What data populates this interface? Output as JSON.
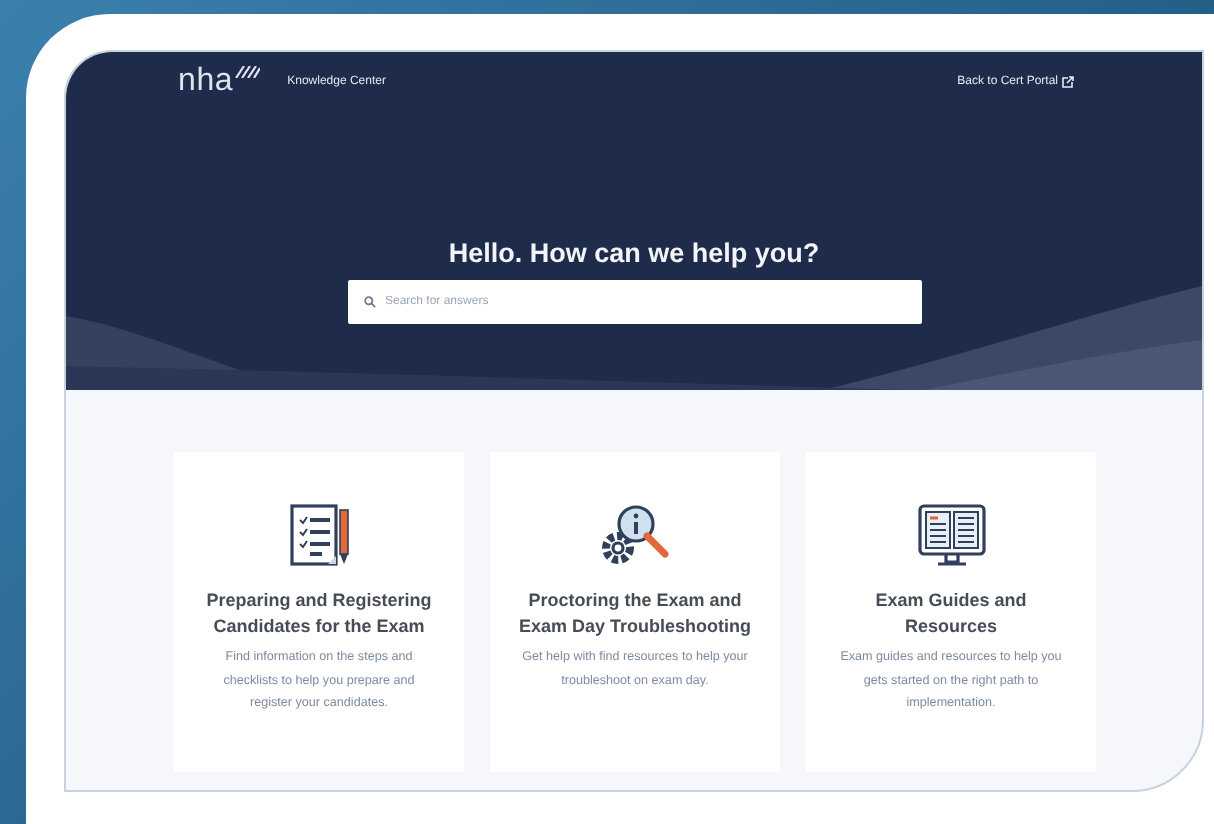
{
  "header": {
    "logo": "nha",
    "nav_link": "Knowledge Center",
    "back_link": "Back to Cert Portal"
  },
  "hero": {
    "title": "Hello. How can we help you?",
    "search": {
      "placeholder": "Search for answers"
    }
  },
  "cards": [
    {
      "kind": "checklist",
      "title": "Preparing and Registering Candidates for the Exam",
      "description": "Find information on the steps and checklists to help you prepare and register your candidates."
    },
    {
      "kind": "troubleshoot",
      "title": "Proctoring the Exam and Exam Day Troubleshooting",
      "description": "Get help with find resources to help your troubleshoot on exam day."
    },
    {
      "kind": "guide",
      "title": "Exam Guides and Resources",
      "description": "Exam guides and resources to help you gets started on the right path to implementation."
    }
  ]
}
